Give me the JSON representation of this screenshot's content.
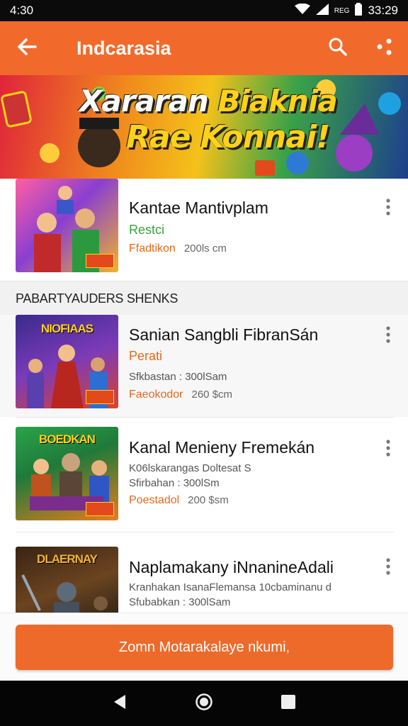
{
  "status_bar": {
    "time_left": "4:30",
    "network": "REG",
    "time_right": "33:29"
  },
  "app_bar": {
    "title": "Indcarasia"
  },
  "banner": {
    "line1_a": "Xararan",
    "line1_b": "Biaknia",
    "line2": "Rae Konnai!"
  },
  "featured": {
    "title": "Kantae Mantivplam",
    "tag": "Restci",
    "meta_orange": "Ffadtikon",
    "meta_gray": "200ls cm"
  },
  "section_header": "PABARTYAUDERS SHENKS",
  "items": [
    {
      "thumb_text": "NIOFIAAS",
      "title": "Sanian Sangbli FibranSán",
      "tag": "Perati",
      "meta1": "Sfkbastan : 300lSam",
      "meta_orange": "Faeokodor",
      "meta_gray": "260 $cm"
    },
    {
      "thumb_text": "BOEDKAN",
      "title": "Kanal Menieny Fremekán",
      "line2": "K06lskarangas Doltesat S",
      "meta1": "Sfirbahan : 300lSm",
      "meta_orange": "Poestadol",
      "meta_gray": "200 $sm"
    },
    {
      "thumb_text": "DLAERNAY",
      "title": "Naplamakany iNnanineAdali",
      "line2": "Kranhakan IsanaFlemansa 10cbaminanu d",
      "meta1": "Sfubabkan : 300lSam"
    }
  ],
  "cta": {
    "label": "Zomn Motarakalaye nkumi,"
  },
  "colors": {
    "brand": "#f26a2b",
    "accent_green": "#37a33d",
    "accent_orange": "#e36a1a"
  },
  "icons": [
    "back-arrow-icon",
    "search-icon",
    "share-icon",
    "more-vert-icon",
    "nav-back-icon",
    "nav-home-icon",
    "nav-recents-icon"
  ]
}
